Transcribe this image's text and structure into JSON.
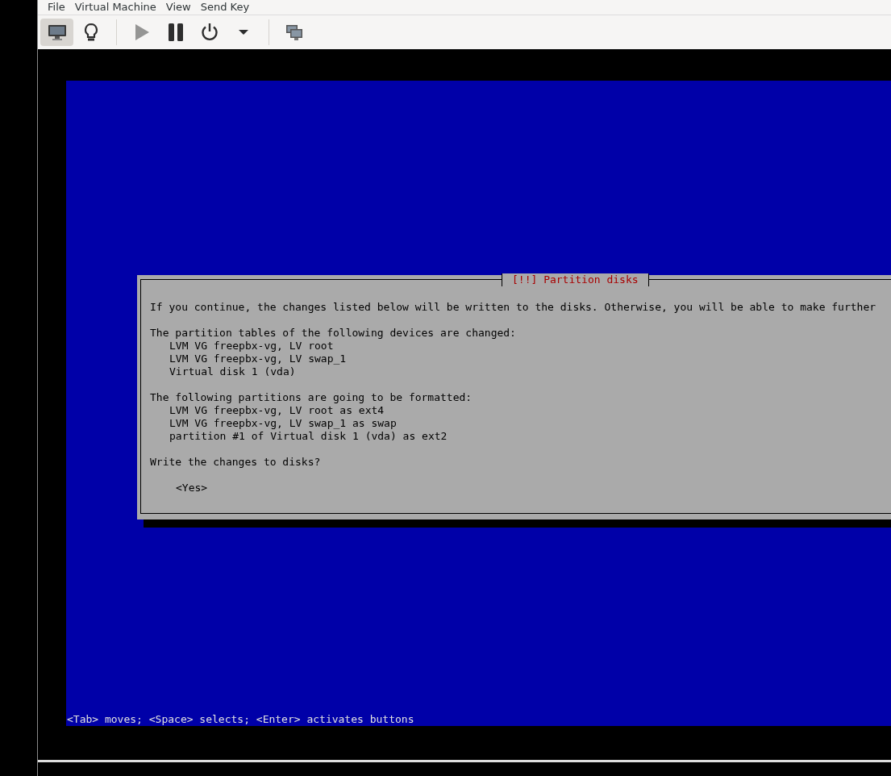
{
  "menu_bar": [
    "File",
    "Virtual Machine",
    "View",
    "Send Key"
  ],
  "toolbar": [
    {
      "kind": "console",
      "selected": true,
      "disabled": false
    },
    {
      "kind": "details",
      "selected": false,
      "disabled": false
    },
    {
      "kind": "separator"
    },
    {
      "kind": "run",
      "selected": false,
      "disabled": true
    },
    {
      "kind": "pause",
      "selected": false,
      "disabled": false
    },
    {
      "kind": "power",
      "selected": false,
      "disabled": false
    },
    {
      "kind": "caret",
      "selected": false,
      "disabled": false
    },
    {
      "kind": "separator"
    },
    {
      "kind": "fullscreen",
      "selected": false,
      "disabled": false
    }
  ],
  "dialog": {
    "title": "[!!] Partition disks",
    "intro": "If you continue, the changes listed below will be written to the disks. Otherwise, you will be able to make further",
    "sections": [
      {
        "heading": "The partition tables of the following devices are changed:",
        "items": [
          "LVM VG freepbx-vg, LV root",
          "LVM VG freepbx-vg, LV swap_1",
          "Virtual disk 1 (vda)"
        ]
      },
      {
        "heading": "The following partitions are going to be formatted:",
        "items": [
          "LVM VG freepbx-vg, LV root as ext4",
          "LVM VG freepbx-vg, LV swap_1 as swap",
          "partition #1 of Virtual disk 1 (vda) as ext2"
        ]
      }
    ],
    "question": "Write the changes to disks?",
    "buttons": [
      "<Yes>"
    ]
  },
  "help_line": "<Tab> moves; <Space> selects; <Enter> activates buttons"
}
